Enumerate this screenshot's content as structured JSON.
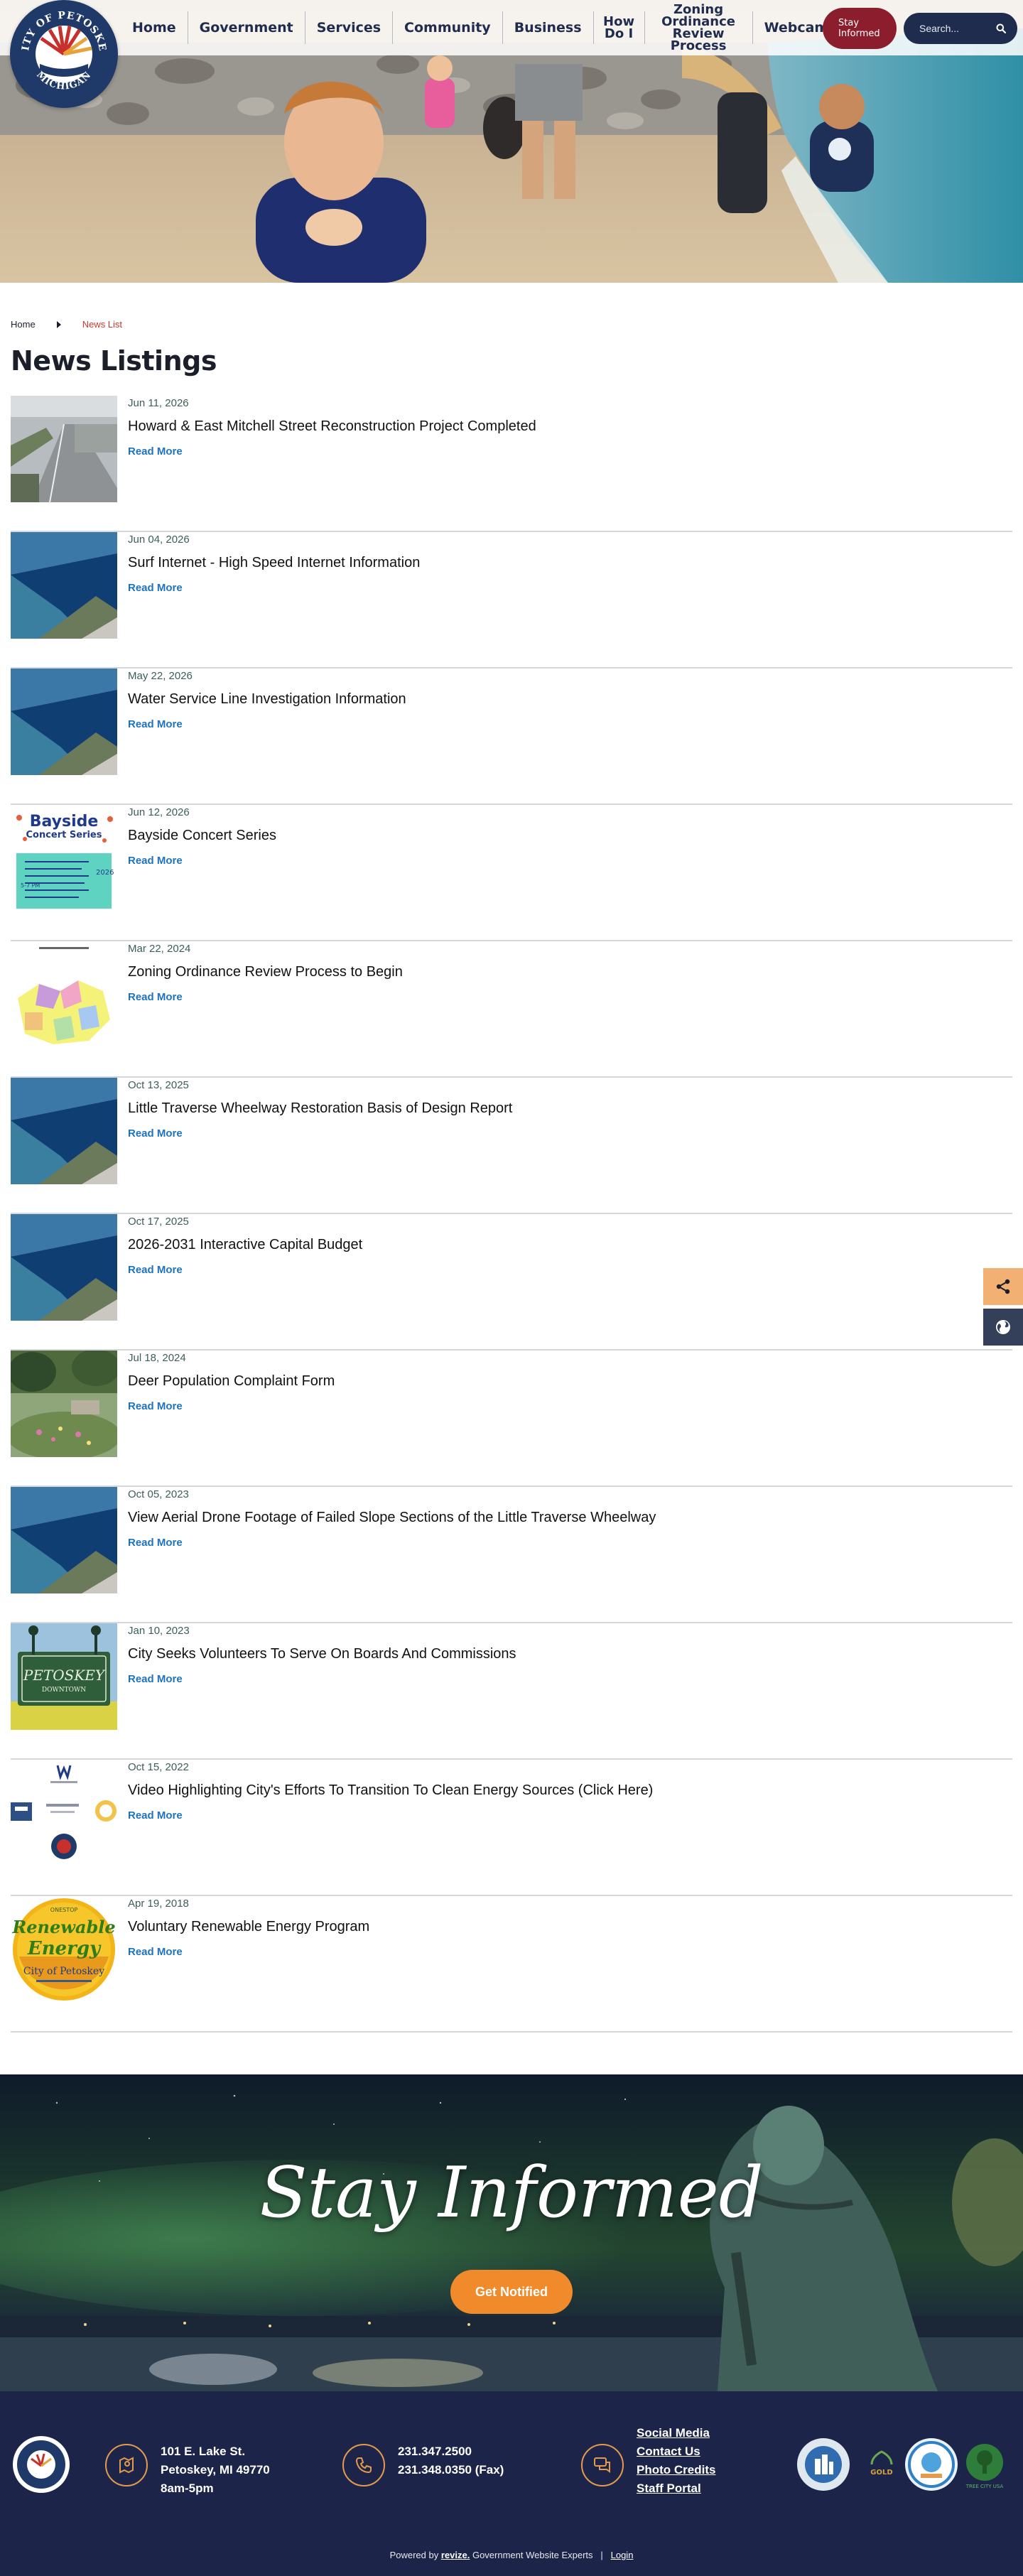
{
  "header": {
    "logo_text": {
      "top": "CITY OF PETOSKEY",
      "bottom": "MICHIGAN"
    },
    "nav": [
      {
        "label": "Home"
      },
      {
        "label": "Government"
      },
      {
        "label": "Services"
      },
      {
        "label": "Community"
      },
      {
        "label": "Business"
      },
      {
        "label": "How Do I"
      },
      {
        "label": "Zoning Ordinance Review Process"
      },
      {
        "label": "Webcams"
      }
    ],
    "stay_informed_label": "Stay Informed",
    "search_placeholder": "Search..."
  },
  "breadcrumb": {
    "home": "Home",
    "current": "News List"
  },
  "page_title": "News Listings",
  "news": [
    {
      "date": "Jun 11, 2026",
      "title": "Howard & East Mitchell Street Reconstruction Project Completed",
      "read_more": "Read More",
      "thumb": "street-aerial"
    },
    {
      "date": "Jun 04, 2026",
      "title": "Surf Internet - High Speed Internet Information",
      "read_more": "Read More",
      "thumb": "bay-aerial"
    },
    {
      "date": "May 22, 2026",
      "title": "Water Service Line Investigation Information",
      "read_more": "Read More",
      "thumb": "bay-aerial"
    },
    {
      "date": "Jun 12, 2026",
      "title": "Bayside Concert Series",
      "read_more": "Read More",
      "thumb": "concert-poster"
    },
    {
      "date": "Mar 22, 2024",
      "title": "Zoning Ordinance Review Process to Begin",
      "read_more": "Read More",
      "thumb": "zoning-map"
    },
    {
      "date": "Oct 13, 2025",
      "title": "Little Traverse Wheelway Restoration Basis of Design Report",
      "read_more": "Read More",
      "thumb": "bay-aerial"
    },
    {
      "date": "Oct 17, 2025",
      "title": "2026-2031 Interactive Capital Budget",
      "read_more": "Read More",
      "thumb": "bay-aerial"
    },
    {
      "date": "Jul 18, 2024",
      "title": "Deer Population Complaint Form",
      "read_more": "Read More",
      "thumb": "park-garden"
    },
    {
      "date": "Oct 05, 2023",
      "title": "View Aerial Drone Footage of Failed Slope Sections of the Little Traverse Wheelway",
      "read_more": "Read More",
      "thumb": "bay-aerial"
    },
    {
      "date": "Jan 10, 2023",
      "title": "City Seeks Volunteers To Serve On Boards And Commissions",
      "read_more": "Read More",
      "thumb": "downtown-sign"
    },
    {
      "date": "Oct 15, 2022",
      "title": "Video Highlighting City's Efforts To Transition To Clean Energy Sources (Click Here)",
      "read_more": "Read More",
      "thumb": "energy-logos"
    },
    {
      "date": "Apr 19, 2018",
      "title": "Voluntary Renewable Energy Program",
      "read_more": "Read More",
      "thumb": "renewable-badge"
    }
  ],
  "thumb_text": {
    "concert_title": "Bayside",
    "concert_sub": "Concert Series",
    "concert_year": "2026",
    "concert_time": "5-7 PM",
    "downtown": "PETOSKEY",
    "downtown_sub": "DOWNTOWN",
    "renewable_top": "ONESTOP",
    "renewable_1": "Renewable",
    "renewable_2": "Energy",
    "renewable_city": "City of Petoskey"
  },
  "side_buttons": {
    "share": "share-icon",
    "globe": "globe-icon"
  },
  "banner": {
    "title": "Stay Informed",
    "button": "Get Notified"
  },
  "footer": {
    "address": [
      "101 E. Lake St.",
      "Petoskey, MI 49770",
      "8am-5pm"
    ],
    "phone": [
      "231.347.2500",
      "231.348.0350 (Fax)"
    ],
    "links": [
      "Social Media",
      "Contact Us",
      "Photo Credits",
      "Staff Portal"
    ],
    "badge_gold": "GOLD",
    "badge_tree": "TREE CITY USA",
    "powered_prefix": "Powered by",
    "powered_brand": "revize.",
    "powered_suffix": "Government Website Experts",
    "separator": "|",
    "login": "Login"
  },
  "colors": {
    "navy": "#1f2c4d",
    "maroon": "#8c1d2c",
    "orange": "#f08a2a",
    "link_blue": "#1e73be",
    "footer_bg": "#1c2549"
  }
}
